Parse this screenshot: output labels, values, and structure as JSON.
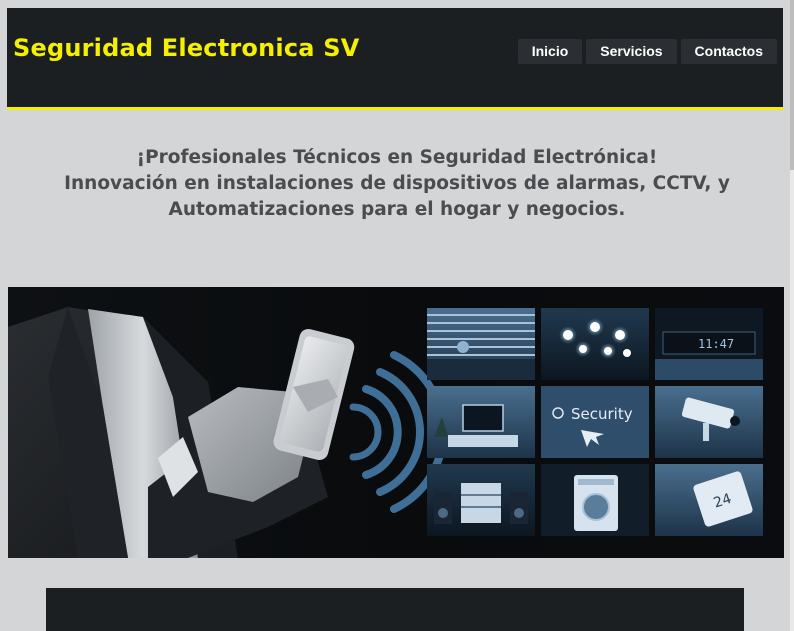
{
  "header": {
    "brand": "Seguridad Electronica SV",
    "nav": [
      {
        "label": "Inicio"
      },
      {
        "label": "Servicios"
      },
      {
        "label": "Contactos"
      }
    ]
  },
  "hero": {
    "line1": "¡Profesionales Técnicos en Seguridad Electrónica!",
    "line2": "Innovación en instalaciones de dispositivos de alarmas, CCTV, y",
    "line3": "Automatizaciones para el hogar y negocios."
  },
  "banner": {
    "security_tile_text": "Security",
    "clock_tile_text": "11:47",
    "thermo_tile_text": "24"
  },
  "colors": {
    "brand_yellow": "#f4f000",
    "header_bg": "#1b1f22",
    "page_bg": "#d4d5d7",
    "hero_text": "#4a4c4f"
  }
}
